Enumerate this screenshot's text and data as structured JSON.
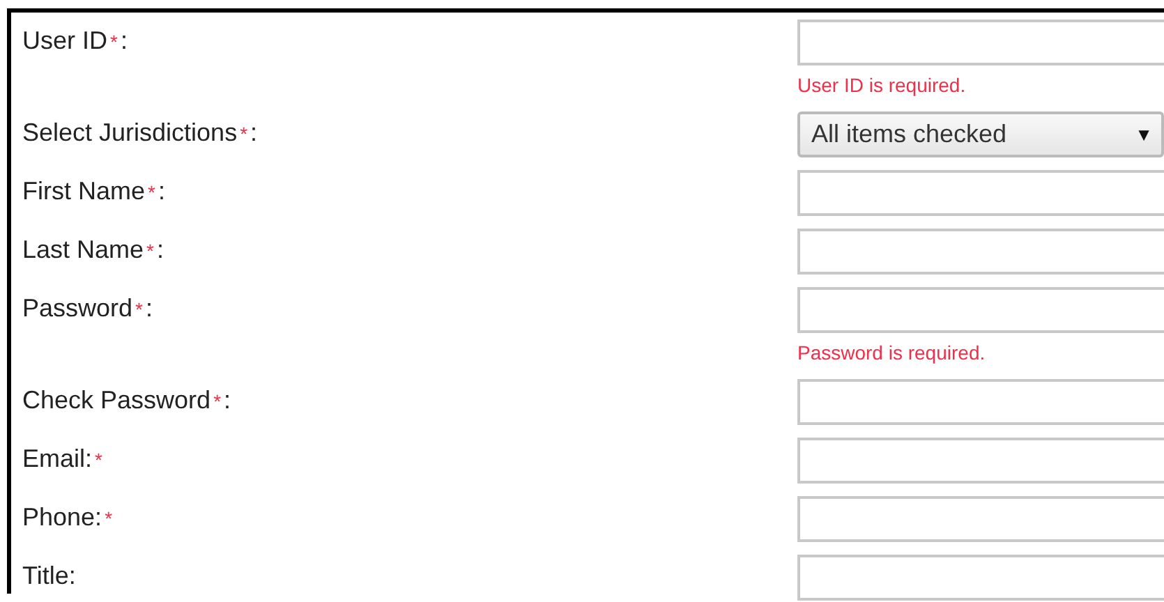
{
  "fields": [
    {
      "label": [
        {
          "kind": "plain",
          "text": "User ID"
        },
        {
          "kind": "required",
          "text": "*"
        },
        {
          "kind": "plain",
          "text": ":"
        }
      ],
      "control": {
        "kind": "text"
      },
      "error": "User ID is required."
    },
    {
      "label": [
        {
          "kind": "plain",
          "text": "Select Jurisdictions"
        },
        {
          "kind": "required",
          "text": "*"
        },
        {
          "kind": "plain",
          "text": ":"
        }
      ],
      "control": {
        "kind": "select",
        "value": "All items checked",
        "arrow": "▼"
      }
    },
    {
      "label": [
        {
          "kind": "plain",
          "text": "First Name"
        },
        {
          "kind": "required",
          "text": "*"
        },
        {
          "kind": "plain",
          "text": ":"
        }
      ],
      "control": {
        "kind": "text"
      }
    },
    {
      "label": [
        {
          "kind": "plain",
          "text": "Last Name"
        },
        {
          "kind": "required",
          "text": "*"
        },
        {
          "kind": "plain",
          "text": ":"
        }
      ],
      "control": {
        "kind": "text"
      }
    },
    {
      "label": [
        {
          "kind": "plain",
          "text": "Password"
        },
        {
          "kind": "required",
          "text": "*"
        },
        {
          "kind": "plain",
          "text": ":"
        }
      ],
      "control": {
        "kind": "text"
      },
      "error": "Password is required."
    },
    {
      "label": [
        {
          "kind": "plain",
          "text": "Check Password"
        },
        {
          "kind": "required",
          "text": "*"
        },
        {
          "kind": "plain",
          "text": ":"
        }
      ],
      "control": {
        "kind": "text"
      }
    },
    {
      "label": [
        {
          "kind": "plain",
          "text": "Email:"
        },
        {
          "kind": "required",
          "text": "*"
        }
      ],
      "control": {
        "kind": "text"
      }
    },
    {
      "label": [
        {
          "kind": "plain",
          "text": "Phone:"
        },
        {
          "kind": "required",
          "text": "*"
        }
      ],
      "control": {
        "kind": "text"
      }
    },
    {
      "label": [
        {
          "kind": "plain",
          "text": "Title:"
        }
      ],
      "control": {
        "kind": "text"
      }
    }
  ]
}
